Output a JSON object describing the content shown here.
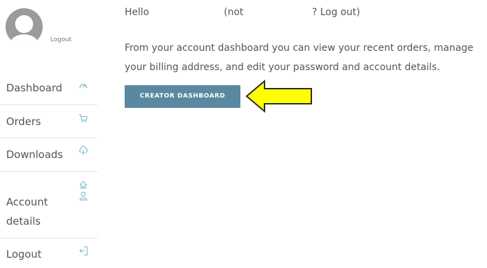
{
  "user": {
    "avatar_logout": "Logout"
  },
  "greeting": {
    "hello": "Hello",
    "not": "(not",
    "logout": "? Log out)"
  },
  "intro_text": "From your account dashboard you can view your recent orders, manage your billing address, and edit your password and account details.",
  "creator_button": "CREATOR DASHBOARD",
  "nav": {
    "items": [
      {
        "label": "Dashboard",
        "icon": "dashboard-icon"
      },
      {
        "label": "Orders",
        "icon": "cart-icon"
      },
      {
        "label": "Downloads",
        "icon": "cloud-download-icon"
      },
      {
        "label": "Account",
        "label2": "details",
        "icon": "home-user-icon"
      },
      {
        "label": "Logout",
        "icon": "logout-icon"
      }
    ]
  },
  "colors": {
    "accent": "#5a88a0",
    "arrow": "#ffff00",
    "icon": "#7ec0cf"
  }
}
